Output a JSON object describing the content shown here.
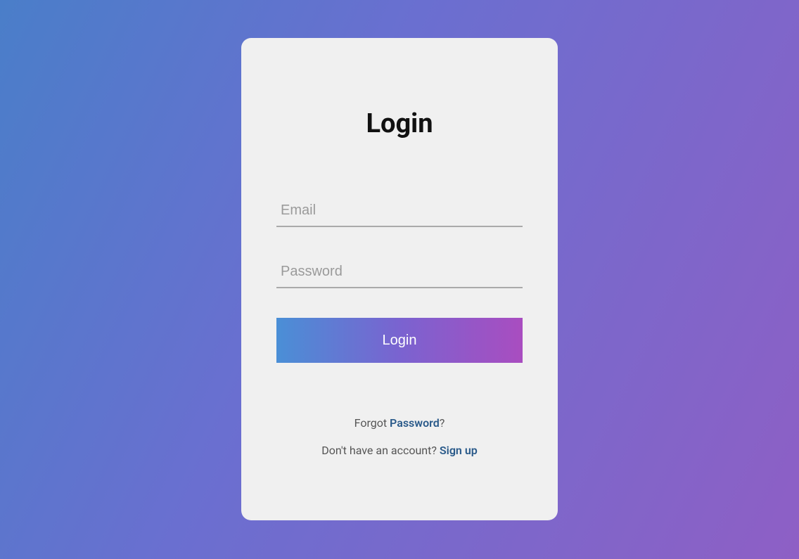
{
  "card": {
    "title": "Login",
    "email": {
      "placeholder": "Email",
      "value": ""
    },
    "password": {
      "placeholder": "Password",
      "value": ""
    },
    "submit_label": "Login",
    "forgot": {
      "prefix": "Forgot ",
      "link": "Password",
      "suffix": "?"
    },
    "signup": {
      "prefix": "Don't have an account? ",
      "link": "Sign up"
    }
  }
}
